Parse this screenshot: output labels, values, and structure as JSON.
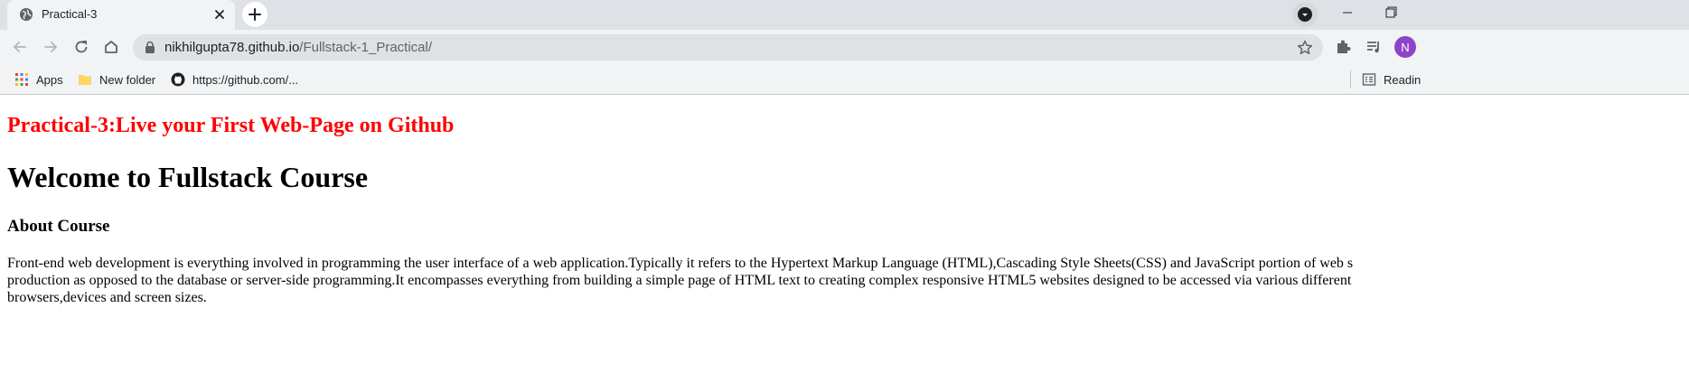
{
  "browser": {
    "tab": {
      "title": "Practical-3"
    },
    "omnibox": {
      "host": "nikhilgupta78.github.io",
      "path": "/Fullstack-1_Practical/"
    },
    "profile": {
      "initial": "N",
      "color": "#8e44c9"
    },
    "bookmarks": [
      {
        "label": "Apps",
        "icon": "apps-grid-icon"
      },
      {
        "label": "New folder",
        "icon": "folder-icon"
      },
      {
        "label": "https://github.com/...",
        "icon": "github-icon"
      }
    ],
    "reading_list": {
      "label": "Readin"
    }
  },
  "page": {
    "practical_heading": "Practical-3:Live your First Web-Page on Github",
    "main_heading": "Welcome to Fullstack Course",
    "about_heading": "About Course",
    "about_lines": [
      "Front-end web development is everything involved in programming the user interface of a web application.Typically it refers to the Hypertext Markup Language (HTML),Cascading Style Sheets(CSS) and JavaScript portion of web s",
      "production as opposed to the database or server-side programming.It encompasses everything from building a simple page of HTML text to creating complex responsive HTML5 websites designed to be accessed via various different",
      "browsers,devices and screen sizes."
    ],
    "colors": {
      "practical_heading": "#ff0000",
      "text": "#000000"
    }
  }
}
